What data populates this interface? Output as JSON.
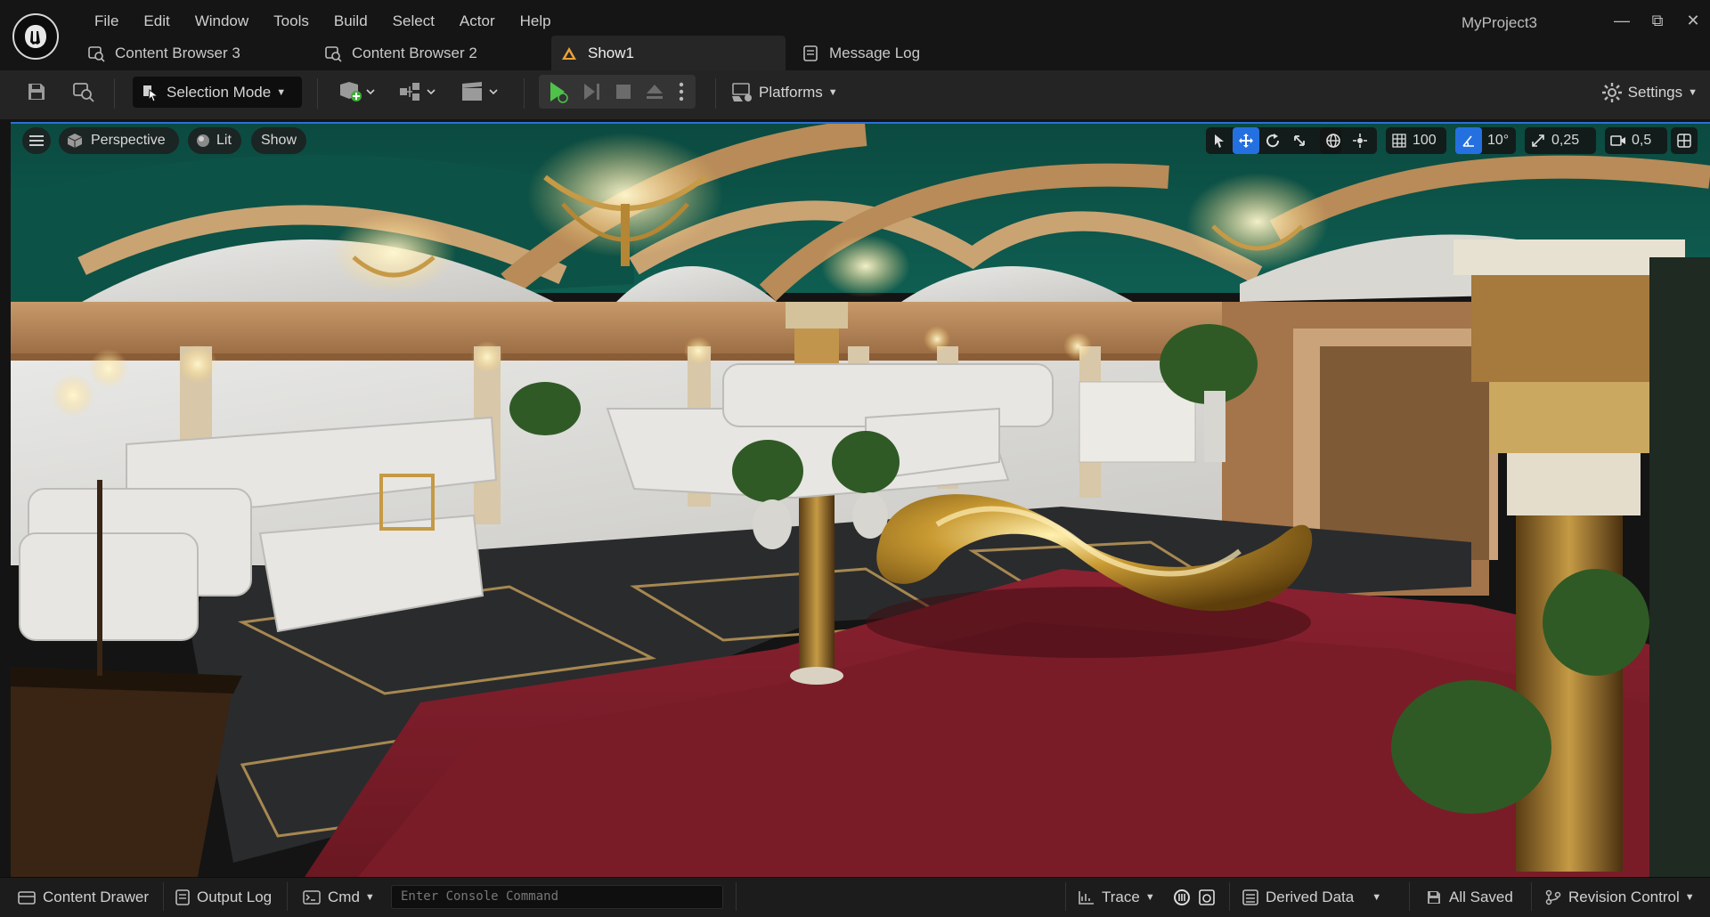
{
  "app": {
    "project_title": "MyProject3"
  },
  "menu": [
    "File",
    "Edit",
    "Window",
    "Tools",
    "Build",
    "Select",
    "Actor",
    "Help"
  ],
  "tabs": [
    {
      "label": "Content Browser 3",
      "icon": "content-browser-icon",
      "active": false
    },
    {
      "label": "Content Browser 2",
      "icon": "content-browser-icon",
      "active": false
    },
    {
      "label": "Show1",
      "icon": "level-icon",
      "active": true
    },
    {
      "label": "Message Log",
      "icon": "message-log-icon",
      "active": false
    }
  ],
  "toolbar": {
    "selection_mode": "Selection Mode",
    "platforms": "Platforms",
    "settings": "Settings"
  },
  "viewport": {
    "perspective": "Perspective",
    "lit": "Lit",
    "show": "Show",
    "grid_snap": "100",
    "rotation_snap": "10°",
    "scale_snap": "0,25",
    "camera_speed": "0,5"
  },
  "statusbar": {
    "content_drawer": "Content Drawer",
    "output_log": "Output Log",
    "cmd": "Cmd",
    "console_placeholder": "Enter Console Command",
    "trace": "Trace",
    "derived_data": "Derived Data",
    "all_saved": "All Saved",
    "revision_control": "Revision Control"
  },
  "colors": {
    "accent": "#2470e0",
    "play": "#4fc24a",
    "carpet": "#6e1a22",
    "ceiling": "#0f5a4e"
  }
}
